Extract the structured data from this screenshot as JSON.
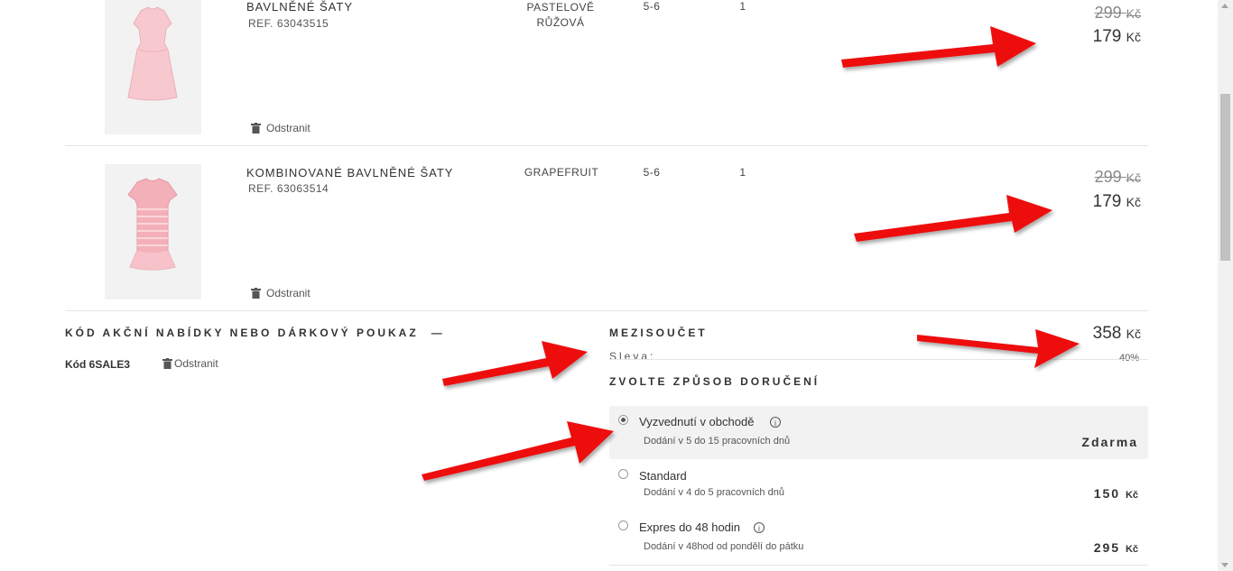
{
  "cart": {
    "items": [
      {
        "name": "BAVLNĚNÉ ŠATY",
        "ref": "REF. 63043515",
        "color": "PASTELOVĚ\nRŮŽOVÁ",
        "color_line1": "PASTELOVĚ",
        "color_line2": "RŮŽOVÁ",
        "size": "5-6",
        "qty": "1",
        "old_price": "299",
        "new_price": "179",
        "currency": "Kč",
        "remove_label": "Odstranit"
      },
      {
        "name": "KOMBINOVANÉ BAVLNĚNÉ ŠATY",
        "ref": "REF. 63063514",
        "color": "GRAPEFRUIT",
        "size": "5-6",
        "qty": "1",
        "old_price": "299",
        "new_price": "179",
        "currency": "Kč",
        "remove_label": "Odstranit"
      }
    ]
  },
  "promo": {
    "heading": "KÓD AKČNÍ NABÍDKY NEBO DÁRKOVÝ POUKAZ",
    "toggle": "—",
    "code": "Kód 6SALE3",
    "remove_label": "Odstranit"
  },
  "summary": {
    "subtotal_label": "MEZISOUČET",
    "subtotal_value": "358",
    "currency": "Kč",
    "discount_label": "Sleva:",
    "discount_value": "40%"
  },
  "delivery": {
    "heading": "ZVOLTE ZPŮSOB DORUČENÍ",
    "options": [
      {
        "label": "Vyzvednutí v obchodě",
        "sub": "Dodání v 5 do 15 pracovních dnů",
        "price": "Zdarma",
        "currency": "",
        "selected": true,
        "info": true
      },
      {
        "label": "Standard",
        "sub": "Dodání v 4 do 5 pracovních dnů",
        "price": "150",
        "currency": "Kč",
        "selected": false,
        "info": false
      },
      {
        "label": "Expres do 48 hodin",
        "sub": "Dodání v 48hod od pondělí do pátku",
        "price": "295",
        "currency": "Kč",
        "selected": false,
        "info": true
      }
    ]
  },
  "icons": {
    "trash": "trash-icon",
    "info": "info-icon",
    "arrow": "red-arrow-annotation"
  },
  "colors": {
    "annotation_red": "#ee1111",
    "selected_option_bg": "#f2f2f2",
    "dress_pink": "#f4b8bf"
  }
}
